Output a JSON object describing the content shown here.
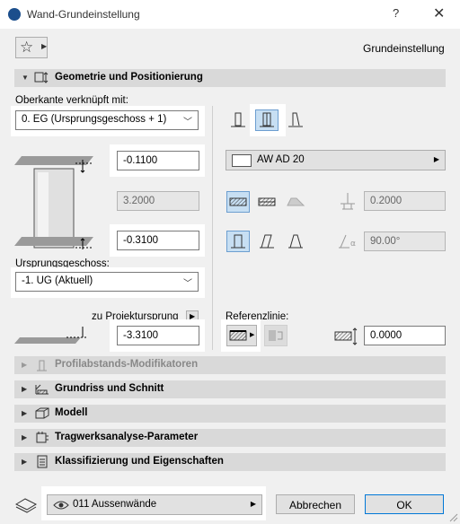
{
  "window": {
    "title": "Wand-Grundeinstellung",
    "help_label": "?",
    "close_label": "✕"
  },
  "header": {
    "favorites_icon": "star-icon",
    "preset_label": "Grundeinstellung"
  },
  "sections": {
    "geometry": "Geometrie und Positionierung",
    "profile": "Profilabstands-Modifikatoren",
    "floorplan": "Grundriss und Schnitt",
    "model": "Modell",
    "structural": "Tragwerksanalyse-Parameter",
    "classification": "Klassifizierung und Eigenschaften"
  },
  "geometry": {
    "top_link_label": "Oberkante verknüpft mit:",
    "top_link_value": "0. EG (Ursprungsgeschoss + 1)",
    "top_offset": "-0.1100",
    "height": "3.2000",
    "bottom_offset": "-0.3100",
    "home_story_label": "Ursprungsgeschoss:",
    "home_story_value": "-1. UG (Aktuell)",
    "project_zero_label": "zu Projektursprung",
    "project_zero_value": "-3.3100",
    "composite": "AW AD 20",
    "thickness": "0.2000",
    "slant_angle": "90.00°",
    "ref_line_label": "Referenzlinie:",
    "ref_line_offset": "0.0000"
  },
  "footer": {
    "layer": "011 Aussenwände",
    "cancel_label": "Abbrechen",
    "ok_label": "OK"
  }
}
